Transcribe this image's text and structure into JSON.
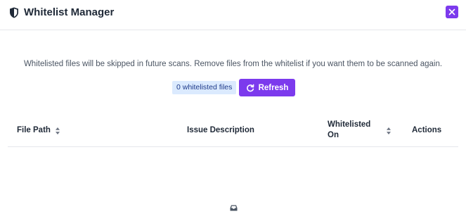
{
  "header": {
    "title": "Whitelist Manager",
    "icon": "shield-icon",
    "close_icon": "close-icon"
  },
  "description": "Whitelisted files will be skipped in future scans. Remove files from the whitelist if you want them to be scanned again.",
  "toolbar": {
    "count_label": "0 whitelisted files",
    "refresh_label": "Refresh",
    "refresh_icon": "refresh-icon"
  },
  "table": {
    "columns": [
      {
        "label": "File Path",
        "sortable": true
      },
      {
        "label": "Issue Description",
        "sortable": false
      },
      {
        "label": "Whitelisted On",
        "sortable": true
      },
      {
        "label": "Actions",
        "sortable": false
      }
    ],
    "rows": [],
    "empty_icon": "inbox-icon"
  },
  "colors": {
    "accent": "#7c3aed",
    "badge_bg": "#dbeafe",
    "badge_text": "#1e3a8a",
    "text": "#1f2937",
    "muted_text": "#4b5563",
    "border": "#e5e7eb"
  }
}
